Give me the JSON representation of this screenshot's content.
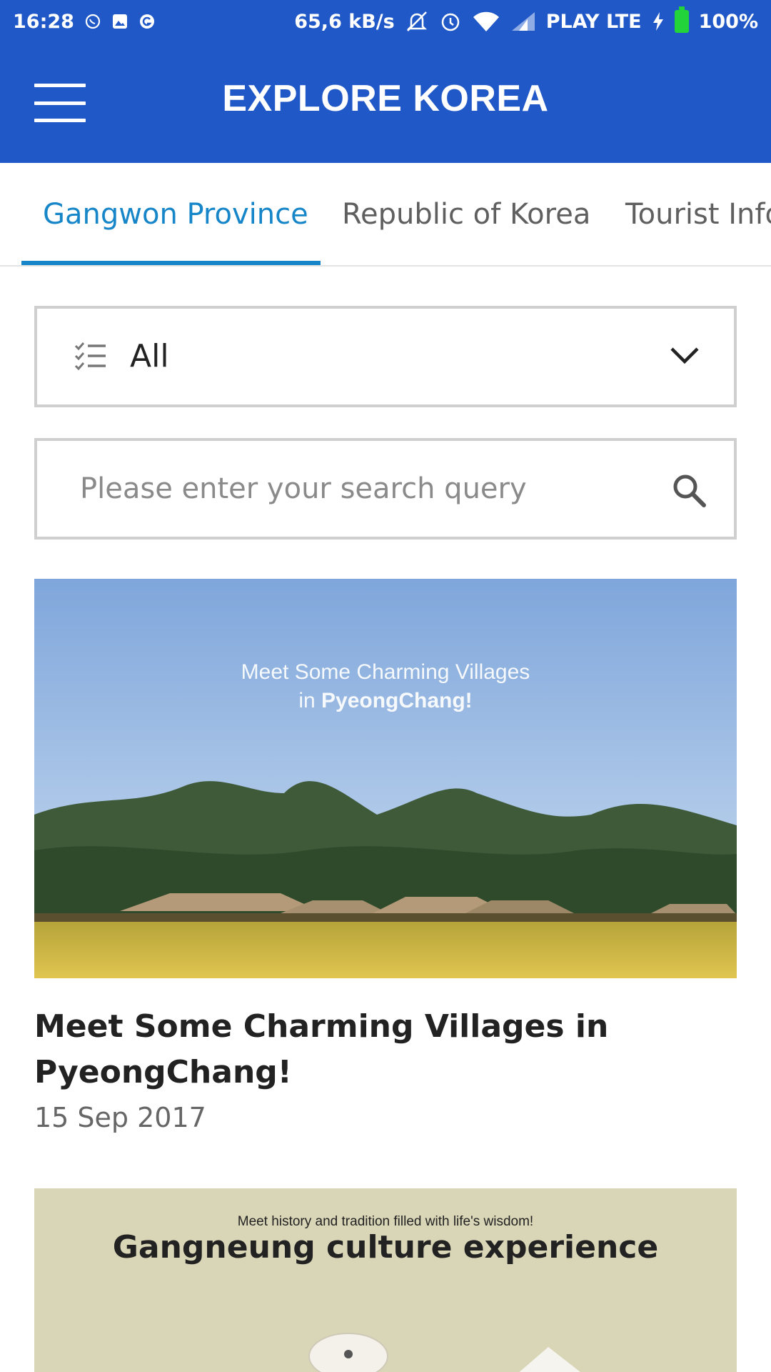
{
  "status_bar": {
    "time": "16:28",
    "speed": "65,6 kB/s",
    "carrier": "PLAY LTE",
    "battery": "100%",
    "icons": [
      "whatsapp-icon",
      "gallery-icon",
      "grammarly-icon",
      "mute-icon",
      "alarm-icon",
      "wifi-icon",
      "signal-icon",
      "charging-icon",
      "battery-icon"
    ]
  },
  "app_bar": {
    "title": "EXPLORE KOREA",
    "menu_icon": "hamburger-menu-icon",
    "color": "#2058c8"
  },
  "tabs": [
    {
      "label": "Gangwon Province",
      "active": true
    },
    {
      "label": "Republic of Korea",
      "active": false
    },
    {
      "label": "Tourist Information",
      "active": false
    }
  ],
  "accent_color": "#1686c8",
  "filter": {
    "selected": "All",
    "icon": "checklist-icon",
    "dropdown_icon": "chevron-down-icon"
  },
  "search": {
    "placeholder": "Please enter your search query",
    "value": "",
    "icon": "search-icon"
  },
  "articles": [
    {
      "image_caption_line1": "Meet Some Charming Villages",
      "image_caption_line2_prefix": "in ",
      "image_caption_line2_bold": "PyeongChang!",
      "title": "Meet Some Charming Villages in PyeongChang!",
      "date": "15 Sep 2017"
    },
    {
      "image_caption_small": "Meet history and tradition filled with life's wisdom!",
      "image_caption_large": "Gangneung culture experience"
    }
  ]
}
